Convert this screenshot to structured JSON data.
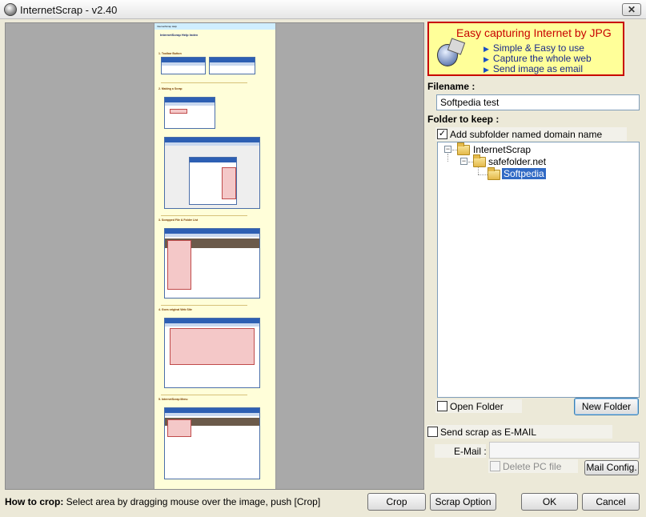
{
  "window": {
    "title": "InternetScrap - v2.40",
    "close_glyph": "✕"
  },
  "preview_page": {
    "header": "InternetScrap Help",
    "title": "InternetScrap Help Index",
    "sections": [
      "1. Toolbar Button",
      "2. Making a Scrap",
      "3. Scrapped File & Folder List",
      "4. Goes original Web Site",
      "5. InternetScrap Menu"
    ]
  },
  "banner": {
    "title": "Easy capturing Internet by JPG",
    "lines": [
      "Simple & Easy to use",
      "Capture the whole web",
      "Send image as email"
    ],
    "bullet_glyph": "▶"
  },
  "filename": {
    "label": "Filename :",
    "value": "Softpedia test"
  },
  "folder": {
    "label": "Folder to keep :",
    "add_subfolder_label": "Add subfolder named domain name",
    "add_subfolder_checked": "✓",
    "tree": [
      {
        "label": "InternetScrap",
        "expander": "−"
      },
      {
        "label": "safefolder.net",
        "expander": "−"
      },
      {
        "label": "Softpedia"
      }
    ],
    "open_folder_label": "Open Folder",
    "new_folder_label": "New Folder"
  },
  "email": {
    "send_label": "Send scrap as E-MAIL",
    "email_label": "E-Mail :",
    "email_value": "",
    "delete_pc_label": "Delete PC file",
    "mail_config_label": "Mail Config."
  },
  "footer": {
    "how_to_label": "How to crop:",
    "how_to_text": " Select area by dragging mouse over the image, push [Crop]",
    "crop_label": "Crop",
    "scrap_option_label": "Scrap Option",
    "ok_label": "OK",
    "cancel_label": "Cancel"
  }
}
